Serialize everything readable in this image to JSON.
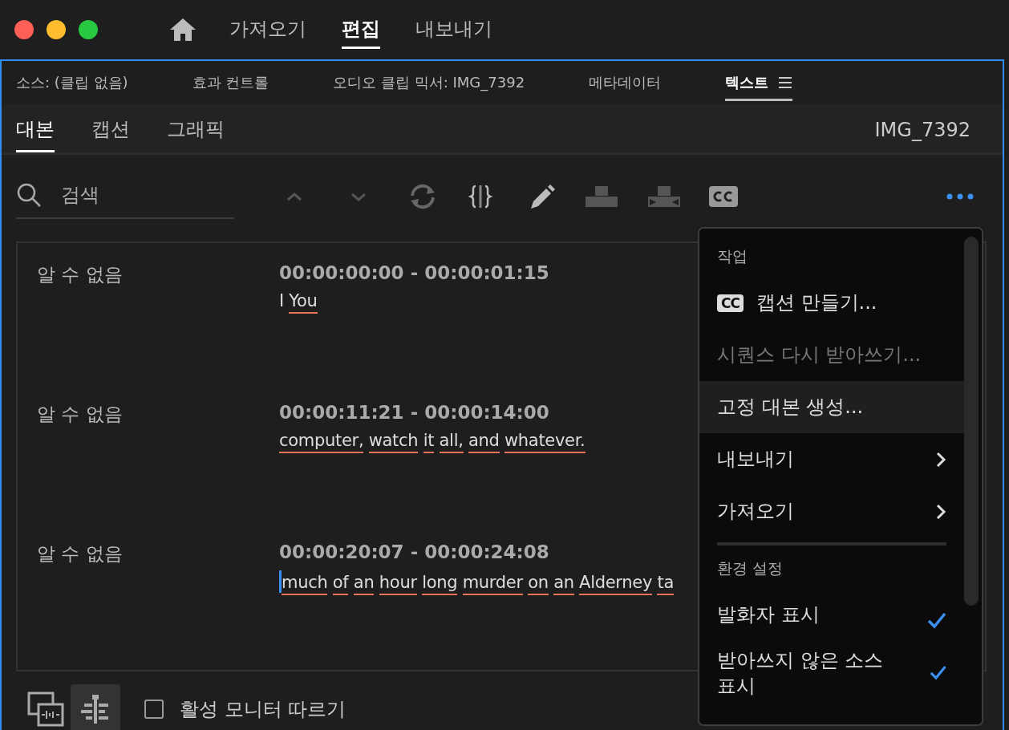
{
  "top_tabs": [
    {
      "label": "가져오기",
      "selected": false
    },
    {
      "label": "편집",
      "selected": true
    },
    {
      "label": "내보내기",
      "selected": false
    }
  ],
  "panel_tabs": [
    {
      "label": "소스: (클립 없음)",
      "selected": false
    },
    {
      "label": "효과 컨트롤",
      "selected": false
    },
    {
      "label": "오디오 클립 믹서: IMG_7392",
      "selected": false
    },
    {
      "label": "메타데이터",
      "selected": false
    },
    {
      "label": "텍스트",
      "selected": true
    }
  ],
  "sub_tabs": [
    {
      "label": "대본",
      "selected": true
    },
    {
      "label": "캡션",
      "selected": false
    },
    {
      "label": "그래픽",
      "selected": false
    }
  ],
  "clip_name": "IMG_7392",
  "search": {
    "placeholder": "검색"
  },
  "transcript": [
    {
      "speaker": "알 수 없음",
      "time": "00:00:00:00 - 00:00:01:15",
      "cursor": false,
      "words": [
        {
          "text": "I",
          "underlined": false
        },
        {
          "text": "You",
          "underlined": true
        }
      ]
    },
    {
      "speaker": "알 수 없음",
      "time": "00:00:11:21 - 00:00:14:00",
      "cursor": false,
      "words": [
        {
          "text": "computer,",
          "underlined": true
        },
        {
          "text": "watch",
          "underlined": true
        },
        {
          "text": "it",
          "underlined": true
        },
        {
          "text": "all,",
          "underlined": true
        },
        {
          "text": "and",
          "underlined": true
        },
        {
          "text": "whatever.",
          "underlined": true
        }
      ]
    },
    {
      "speaker": "알 수 없음",
      "time": "00:00:20:07 - 00:00:24:08",
      "cursor": true,
      "words": [
        {
          "text": "much",
          "underlined": true
        },
        {
          "text": "of",
          "underlined": true
        },
        {
          "text": "an",
          "underlined": true
        },
        {
          "text": "hour",
          "underlined": true
        },
        {
          "text": "long",
          "underlined": true
        },
        {
          "text": "murder",
          "underlined": true
        },
        {
          "text": "on",
          "underlined": true
        },
        {
          "text": "an",
          "underlined": true
        },
        {
          "text": "Alderney",
          "underlined": true
        },
        {
          "text": "ta",
          "underlined": true
        }
      ]
    }
  ],
  "bottom_bar": {
    "view_buttons": [
      {
        "selected": false
      },
      {
        "selected": true
      }
    ],
    "follow_monitor": {
      "label": "활성 모니터 따르기",
      "checked": false
    }
  },
  "menu": [
    {
      "kind": "header",
      "label": "작업"
    },
    {
      "kind": "action",
      "label": "캡션 만들기...",
      "badge": "CC",
      "disabled": false,
      "highlighted": false
    },
    {
      "kind": "action",
      "label": "시퀀스 다시 받아쓰기...",
      "disabled": true,
      "highlighted": false
    },
    {
      "kind": "action",
      "label": "고정 대본 생성...",
      "disabled": false,
      "highlighted": true
    },
    {
      "kind": "submenu",
      "label": "내보내기",
      "highlighted": false
    },
    {
      "kind": "submenu",
      "label": "가져오기",
      "highlighted": false
    },
    {
      "kind": "divider"
    },
    {
      "kind": "header",
      "label": "환경 설정"
    },
    {
      "kind": "check",
      "label": "발화자 표시",
      "checked": true
    },
    {
      "kind": "check",
      "label": "받아쓰지 않은 소스 표시",
      "checked": true
    }
  ]
}
